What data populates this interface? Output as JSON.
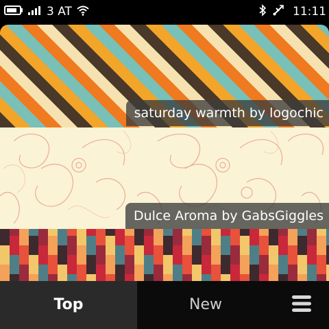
{
  "status_bar": {
    "carrier": "3 AT",
    "time": "11:11",
    "icons": [
      "battery-icon",
      "signal-icon",
      "wifi-icon",
      "bluetooth-icon",
      "usb-icon"
    ]
  },
  "wallpapers": [
    {
      "caption": "saturday warmth by logochic"
    },
    {
      "caption": "Dulce Aroma by GabsGiggles"
    }
  ],
  "tabs": {
    "top": "Top",
    "new": "New",
    "active": "Top"
  },
  "menu_icon": "menu-icon",
  "colors": {
    "stripe_dark": "#4a3828",
    "stripe_orange": "#ef7a20",
    "stripe_amber": "#f3a52a",
    "stripe_teal": "#78c0b8",
    "stripe_cream": "#f6e2b0",
    "damask_bg": "#fbf3d6",
    "damask_ink": "#e8a090",
    "pixel_palette": [
      "#3d2a2e",
      "#c8283a",
      "#e8513a",
      "#f2c76b",
      "#4f7f86",
      "#9a2b3c",
      "#f4a15a"
    ]
  }
}
